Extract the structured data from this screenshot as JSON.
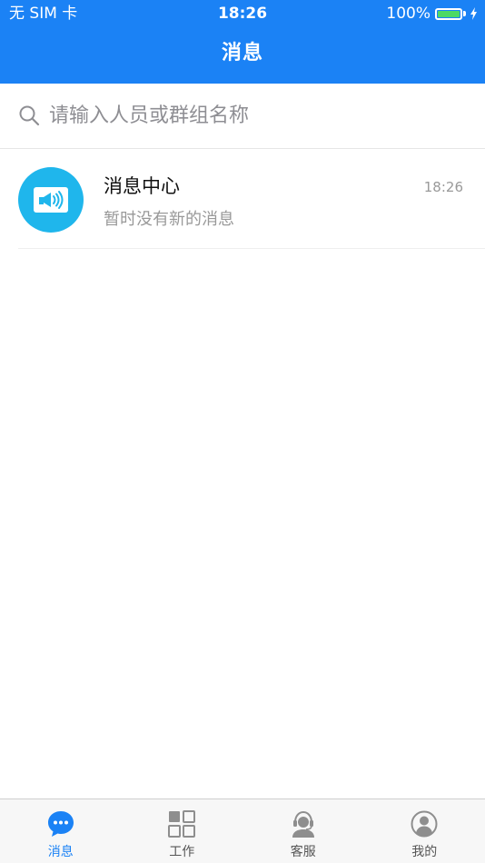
{
  "status_bar": {
    "carrier": "无 SIM 卡",
    "time": "18:26",
    "battery_percent": "100%",
    "battery_level": 1.0
  },
  "nav": {
    "title": "消息"
  },
  "search": {
    "placeholder": "请输入人员或群组名称",
    "value": ""
  },
  "conversations": [
    {
      "name": "消息中心",
      "time": "18:26",
      "preview": "暂时没有新的消息",
      "avatar_icon": "megaphone-icon",
      "avatar_color": "#1fb6ec"
    }
  ],
  "tabbar": {
    "items": [
      {
        "label": "消息",
        "icon": "chat-bubble-icon",
        "active": true
      },
      {
        "label": "工作",
        "icon": "grid-icon",
        "active": false
      },
      {
        "label": "客服",
        "icon": "customer-service-icon",
        "active": false
      },
      {
        "label": "我的",
        "icon": "profile-icon",
        "active": false
      }
    ]
  },
  "colors": {
    "primary": "#1b82f5",
    "inactive": "#8e8e8e",
    "battery_fill": "#4cd964"
  }
}
